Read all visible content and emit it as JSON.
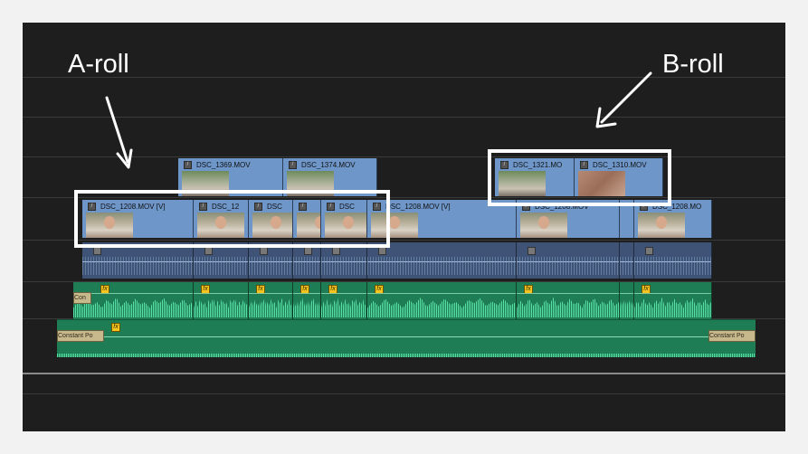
{
  "annotations": {
    "a_roll_label": "A-roll",
    "b_roll_label": "B-roll"
  },
  "icons": {
    "fx": "fx"
  },
  "colors": {
    "video_clip": "#6e96c9",
    "audio_clip_linked": "#3e5375",
    "audio_clip_green": "#1f7d55",
    "waveform": "#58e2a6",
    "fx_badge": "#f3c51e",
    "highlight": "#ffffff",
    "background": "#1e1e1e"
  },
  "video_track_2": {
    "clips": [
      "DSC_1369.MOV",
      "DSC_1374.MOV",
      "DSC_1321.MO",
      "DSC_1310.MOV"
    ]
  },
  "video_track_1": {
    "clips": [
      "DSC_1208.MOV [V]",
      "DSC_12",
      "DSC",
      "DSC",
      "DSC_1208.MOV [V]",
      "DSC_1208.MOV",
      "DSC_1208.MO"
    ]
  },
  "audio_track_2": {
    "transitions": [
      "Con",
      "Constant Po",
      "Constant Po"
    ]
  }
}
